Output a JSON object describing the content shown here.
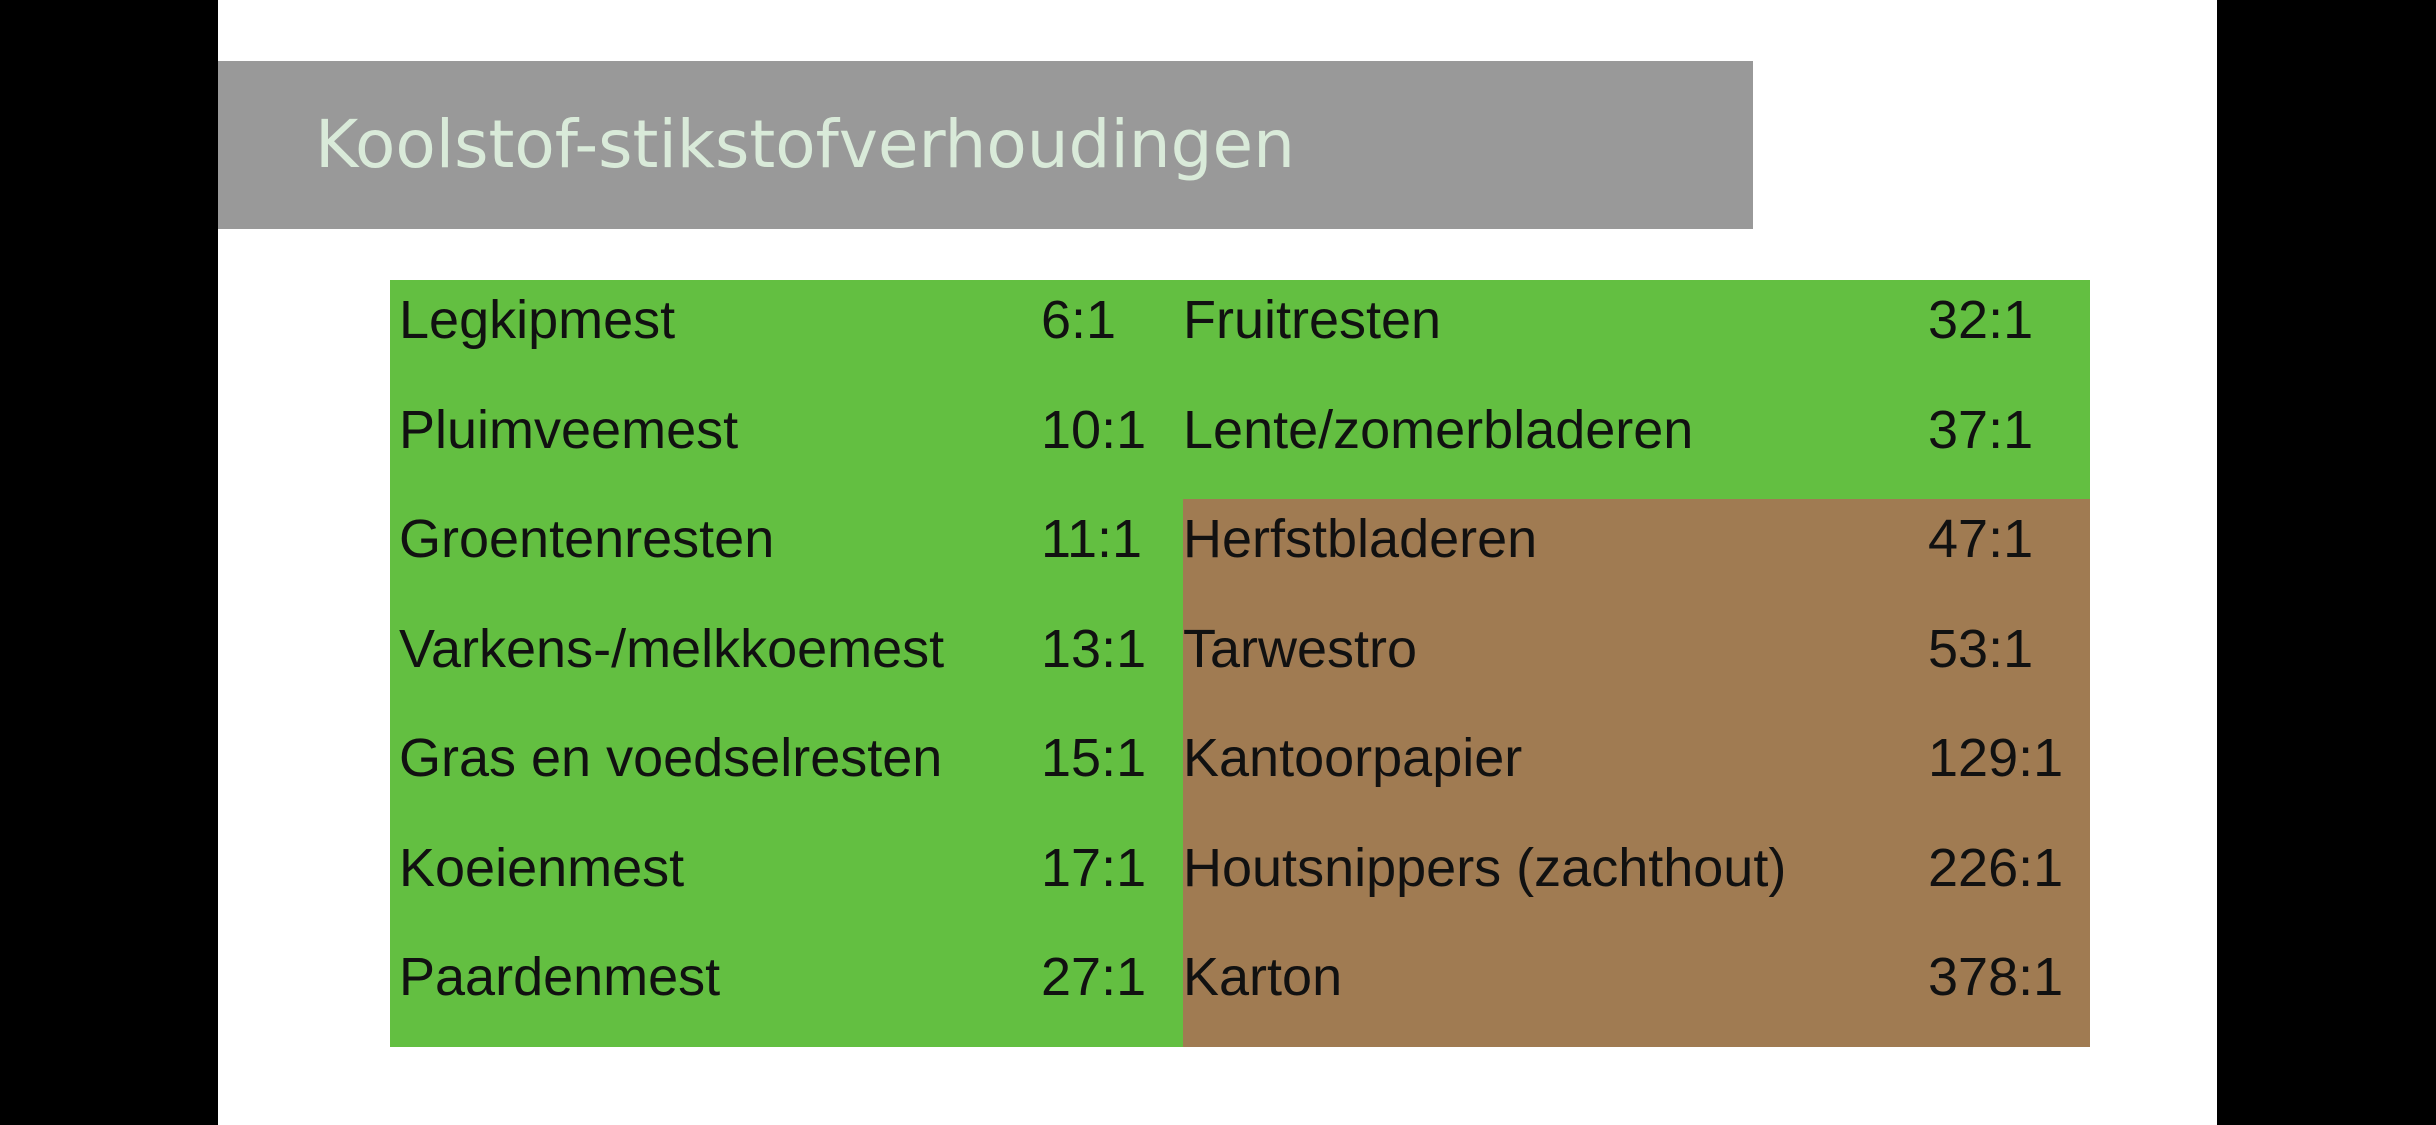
{
  "title": "Koolstof-stikstofverhoudingen",
  "colors": {
    "green": "#63bf41",
    "brown": "#a07b52",
    "title_bar": "#999999",
    "title_text": "#d9ead9"
  },
  "left_column": [
    {
      "name": "Legkipmest",
      "ratio": "6:1",
      "category": "green"
    },
    {
      "name": "Pluimveemest",
      "ratio": "10:1",
      "category": "green"
    },
    {
      "name": "Groentenresten",
      "ratio": "11:1",
      "category": "green"
    },
    {
      "name": "Varkens-/melkkoemest",
      "ratio": "13:1",
      "category": "green"
    },
    {
      "name": "Gras en voedselresten",
      "ratio": "15:1",
      "category": "green"
    },
    {
      "name": "Koeienmest",
      "ratio": "17:1",
      "category": "green"
    },
    {
      "name": "Paardenmest",
      "ratio": "27:1",
      "category": "green"
    }
  ],
  "right_column": [
    {
      "name": "Fruitresten",
      "ratio": "32:1",
      "category": "green"
    },
    {
      "name": "Lente/zomerbladeren",
      "ratio": "37:1",
      "category": "green"
    },
    {
      "name": "Herfstbladeren",
      "ratio": "47:1",
      "category": "brown"
    },
    {
      "name": "Tarwestro",
      "ratio": "53:1",
      "category": "brown"
    },
    {
      "name": "Kantoorpapier",
      "ratio": "129:1",
      "category": "brown"
    },
    {
      "name": "Houtsnippers (zachthout)",
      "ratio": "226:1",
      "category": "brown"
    },
    {
      "name": "Karton",
      "ratio": "378:1",
      "category": "brown"
    }
  ]
}
